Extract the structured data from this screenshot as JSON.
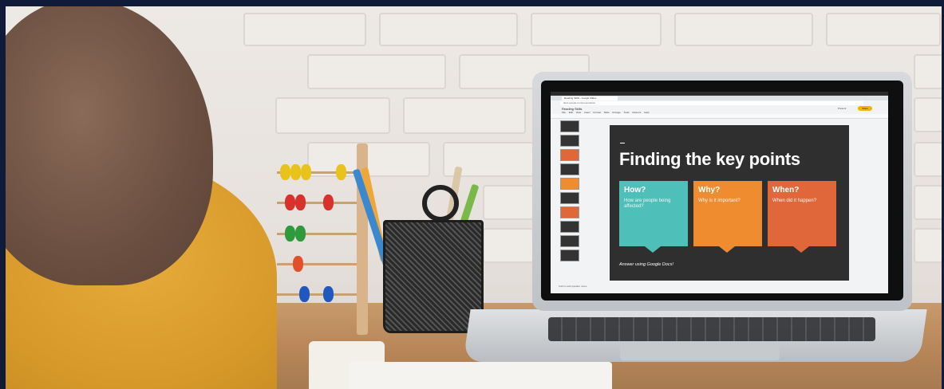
{
  "slides_app": {
    "document_title": "Reading Skills",
    "tab_label": "Reading Skills - Google Slides",
    "url": "docs.google.com/presentation",
    "menus": [
      "File",
      "Edit",
      "View",
      "Insert",
      "Format",
      "Slide",
      "Arrange",
      "Tools",
      "Add-ons",
      "Help"
    ],
    "present_label": "Present",
    "share_label": "Share",
    "notes_placeholder": "Click to add speaker notes"
  },
  "slide": {
    "title": "Finding the key points",
    "cards": [
      {
        "heading": "How?",
        "body": "How are people being affected?",
        "color": "#4fbfb9"
      },
      {
        "heading": "Why?",
        "body": "Why is it important?",
        "color": "#ef8c30"
      },
      {
        "heading": "When?",
        "body": "When did it happen?",
        "color": "#e0673a"
      }
    ],
    "footer": "Answer using Google Docs!"
  },
  "colors": {
    "frame": "#101b3a",
    "slide_background": "#2f2f2f",
    "sweater": "#d89a2a",
    "table": "#b9875a"
  }
}
